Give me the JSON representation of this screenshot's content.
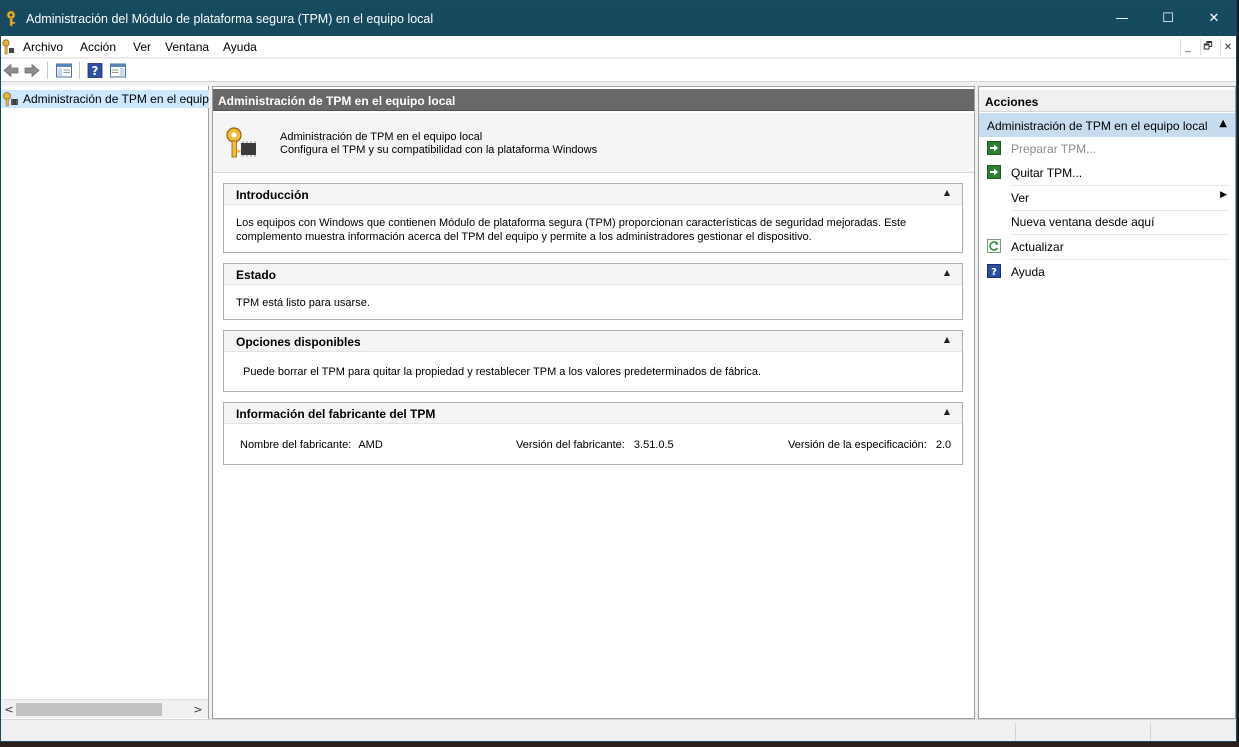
{
  "window": {
    "title": "Administración del Módulo de plataforma segura (TPM) en el equipo local",
    "minimize": "—",
    "maximize": "☐",
    "close": "✕"
  },
  "menu": {
    "items": [
      "Archivo",
      "Acción",
      "Ver",
      "Ventana",
      "Ayuda"
    ],
    "mdi_minimize": "_",
    "mdi_restore": "🗗",
    "mdi_close": "✕"
  },
  "tree": {
    "item_label": "Administración de TPM en el equipo local"
  },
  "scroll": {
    "left": "<",
    "right": ">"
  },
  "center": {
    "header": "Administración de TPM en el equipo local",
    "banner_line1": "Administración de TPM en el equipo local",
    "banner_line2": "Configura el TPM y su compatibilidad con la plataforma Windows",
    "sections": {
      "intro": {
        "title": "Introducción",
        "body_line1": "Los equipos con Windows que contienen Módulo de plataforma segura (TPM) proporcionan características de seguridad mejoradas. Este",
        "body_line2": "complemento muestra información acerca del TPM del equipo y permite a los administradores gestionar el dispositivo."
      },
      "status": {
        "title": "Estado",
        "body": "TPM está listo para usarse."
      },
      "options": {
        "title": "Opciones disponibles",
        "body": "Puede borrar el TPM para quitar la propiedad y restablecer TPM a los valores predeterminados de fábrica."
      },
      "manufacturer": {
        "title": "Información del fabricante del TPM",
        "name_label": "Nombre del fabricante:",
        "name_value": "AMD",
        "version_label": "Versión del fabricante:",
        "version_value": "3.51.0.5",
        "spec_label": "Versión de la especificación:",
        "spec_value": "2.0"
      }
    },
    "collapse_glyph": "▲"
  },
  "actions": {
    "header": "Acciones",
    "group_label": "Administración de TPM en el equipo local",
    "group_glyph": "▲",
    "items": {
      "prepare": "Preparar TPM...",
      "clear": "Quitar TPM...",
      "view": "Ver",
      "new_window": "Nueva ventana desde aquí",
      "refresh": "Actualizar",
      "help": "Ayuda"
    },
    "submenu_glyph": "▶",
    "icons": {
      "prepare": "green-arrow-icon",
      "clear": "green-arrow-icon",
      "refresh": "refresh-icon",
      "help": "help-icon"
    }
  },
  "colors": {
    "titlebar": "#154a5f",
    "center_header": "#686868",
    "action_group": "#c7ddef",
    "tree_selected": "#cce8ff"
  }
}
